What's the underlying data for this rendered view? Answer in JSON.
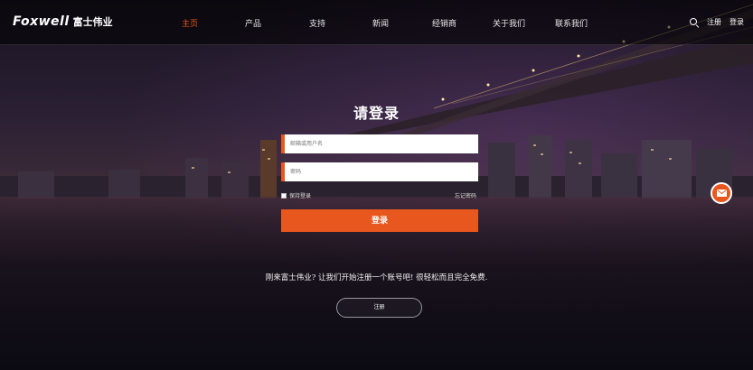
{
  "header": {
    "logo_word": "Foxwell",
    "logo_cn": "富士伟业",
    "nav": [
      {
        "label": "主页",
        "active": true
      },
      {
        "label": "产品",
        "active": false
      },
      {
        "label": "支持",
        "active": false
      },
      {
        "label": "新闻",
        "active": false
      },
      {
        "label": "经销商",
        "active": false
      },
      {
        "label": "关于我们",
        "active": false
      },
      {
        "label": "联系我们",
        "active": false
      }
    ],
    "register_link": "注册",
    "login_link": "登录",
    "search_icon": "search-icon"
  },
  "login": {
    "title": "请登录",
    "username_placeholder": "邮箱或用户名",
    "password_placeholder": "密码",
    "remember_label": "保持登录",
    "remember_checked": false,
    "forgot_label": "忘记密码",
    "submit_label": "登录"
  },
  "signup": {
    "prompt": "刚来富士伟业? 让我们开始注册一个账号吧! 很轻松而且完全免费.",
    "button_label": "注册"
  },
  "fab": {
    "icon": "mail-icon"
  },
  "colors": {
    "accent": "#e8571e",
    "header_bg": "#000000",
    "field_bg": "#ffffff"
  }
}
